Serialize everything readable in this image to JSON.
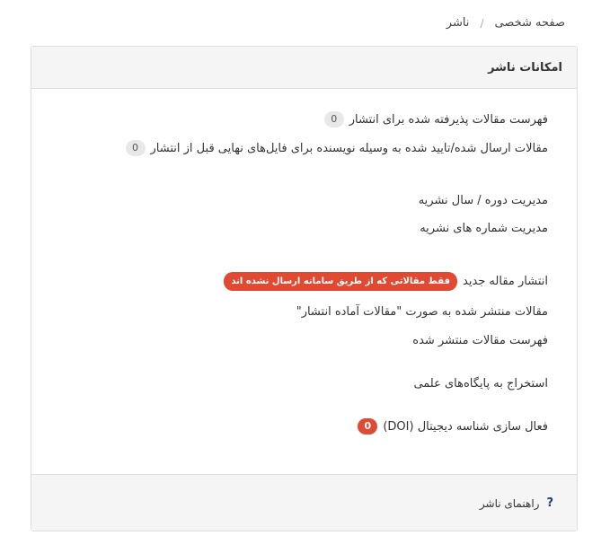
{
  "breadcrumb": {
    "home": "صفحه شخصی",
    "separator": "/",
    "current": "ناشر"
  },
  "panel": {
    "title": "امکانات ناشر"
  },
  "menu": {
    "accepted_list": "فهرست مقالات پذیرفته شده برای انتشار",
    "accepted_count": "0",
    "author_approved": "مقالات ارسال شده/تایید شده به وسیله نویسنده برای فایل‌های نهایی قبل از انتشار",
    "author_approved_count": "0",
    "manage_volumes": "مدیریت دوره / سال نشریه",
    "manage_issues": "مدیریت شماره های نشریه",
    "publish_new": "انتشار مقاله جدید",
    "publish_new_note": "فقط مقالاتی که از طریق سامانه ارسال نشده اند",
    "published_as_ready": "مقالات منتشر شده به صورت \"مقالات آماده انتشار\"",
    "published_list": "فهرست مقالات منتشر شده",
    "indexing_export": "استخراج به پایگاه‌های علمی",
    "doi_activation": "فعال سازی شناسه دیجیتال (DOI)",
    "doi_count": "0"
  },
  "footer": {
    "help_icon": "?",
    "help_label": "راهنمای ناشر"
  },
  "colors": {
    "badge_red": "#e04a33",
    "help_icon": "#1f3d7a"
  }
}
